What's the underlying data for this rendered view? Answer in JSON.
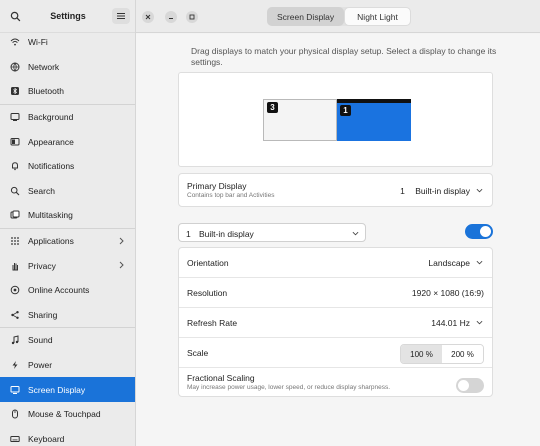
{
  "sidebar": {
    "title": "Settings",
    "items": [
      {
        "label": "Wi-Fi",
        "icon": "wifi-icon"
      },
      {
        "label": "Network",
        "icon": "network-icon"
      },
      {
        "label": "Bluetooth",
        "icon": "bluetooth-icon"
      },
      {
        "label": "Background",
        "icon": "background-icon"
      },
      {
        "label": "Appearance",
        "icon": "appearance-icon"
      },
      {
        "label": "Notifications",
        "icon": "bell-icon"
      },
      {
        "label": "Search",
        "icon": "search-icon"
      },
      {
        "label": "Multitasking",
        "icon": "multitasking-icon"
      },
      {
        "label": "Applications",
        "icon": "apps-icon"
      },
      {
        "label": "Privacy",
        "icon": "hand-icon"
      },
      {
        "label": "Online Accounts",
        "icon": "cloud-icon"
      },
      {
        "label": "Sharing",
        "icon": "share-icon"
      },
      {
        "label": "Sound",
        "icon": "music-note-icon"
      },
      {
        "label": "Power",
        "icon": "power-icon"
      },
      {
        "label": "Screen Display",
        "icon": "display-icon"
      },
      {
        "label": "Mouse & Touchpad",
        "icon": "mouse-icon"
      },
      {
        "label": "Keyboard",
        "icon": "keyboard-icon"
      }
    ]
  },
  "tabs": {
    "display": "Screen Display",
    "night": "Night Light"
  },
  "intro": "Drag displays to match your physical display setup. Select a display to change its settings.",
  "preview": {
    "monitor_a": "3",
    "monitor_b": "1"
  },
  "primary": {
    "label": "Primary Display",
    "sub": "Contains top bar and Activities",
    "value_num": "1",
    "value": "Built-in display"
  },
  "selected_display": {
    "num": "1",
    "label": "Built-in display",
    "enabled": true
  },
  "settings": {
    "orientation_label": "Orientation",
    "orientation_value": "Landscape",
    "resolution_label": "Resolution",
    "resolution_value": "1920 × 1080 (16:9)",
    "refresh_label": "Refresh Rate",
    "refresh_value": "144.01 Hz",
    "scale_label": "Scale",
    "scale_opt1": "100 %",
    "scale_opt2": "200 %",
    "fractional_label": "Fractional Scaling",
    "fractional_sub": "May increase power usage, lower speed, or reduce display sharpness.",
    "fractional_enabled": false
  },
  "colors": {
    "accent": "#1a73d9"
  }
}
